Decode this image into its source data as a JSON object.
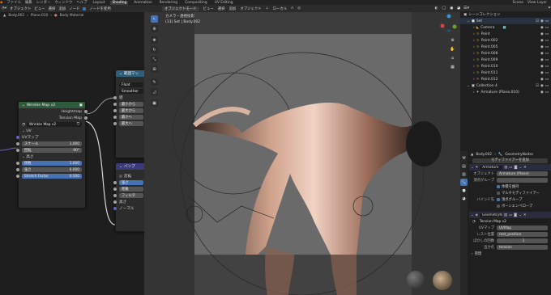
{
  "topbar": {
    "menus": [
      "ファイル",
      "編集",
      "レンダー",
      "ウィンドウ",
      "ヘルプ"
    ],
    "workspaces": [
      "Layout",
      "Shading",
      "Animation",
      "Rendering",
      "Compositing",
      "UV Editing"
    ],
    "active_workspace": "Shading",
    "right_items": [
      "Scene",
      "View Layer"
    ]
  },
  "node_editor": {
    "header": [
      "オブジェクト",
      "ビュー",
      "選択",
      "追加",
      "ノード",
      "ノードを使用"
    ],
    "breadcrumb": [
      "Body.002",
      "Plane.010",
      "Body Material"
    ],
    "wrinkle_node": {
      "title": "Wrinkle Map v2",
      "outputs": [
        "Heightmap",
        "Tension Map"
      ],
      "group_name": "Wrinkle Map v2",
      "section_uv": "UV",
      "uv_map": "UVマップ",
      "scale_label": "スケール",
      "scale_value": "1.000",
      "rotation_label": "回転",
      "rotation_value": "90°",
      "section_height": "高さ",
      "coef_label": "係数",
      "coef_value": "1.000",
      "strength_label": "強さ",
      "strength_value": "6.000",
      "stretch_label": "Stretch Factor",
      "stretch_value": "0.500"
    },
    "map_range_node": {
      "title": "範囲マッ",
      "type_value": "Float",
      "interp_value": "Smoother",
      "sockets": [
        "値",
        "最小から",
        "最大から",
        "最小へ",
        "最大へ"
      ]
    },
    "bump_node": {
      "title": "バンプ",
      "invert": "反転",
      "sockets": [
        "強さ",
        "距離",
        "フィルタ"
      ],
      "bottom": [
        "高さ",
        "ノーマル"
      ]
    }
  },
  "viewport": {
    "header": [
      "オブジェクトモード",
      "ビュー",
      "選択",
      "追加",
      "オブジェクト",
      "ローカル"
    ],
    "camera_title": "カメラ・透視投影",
    "camera_sub": "(13) Set | Body.002"
  },
  "outliner": {
    "title": "シーンコレクション",
    "items": [
      "Set",
      "Camera",
      "Point",
      "Point.002",
      "Point.005",
      "Point.008",
      "Point.009",
      "Point.010",
      "Point.011",
      "Point.012",
      "Collection 4",
      "Armature (Plane.010)"
    ]
  },
  "properties": {
    "breadcrumb": [
      "Body.002",
      "GeometryNodes"
    ],
    "add_modifier": "モディファイアーを追加",
    "armature_name": "Armature",
    "object_label": "オブジェクト",
    "object_value": "Armature (Plane)",
    "vgroup_label": "頂点グループ",
    "preserve_volume": "体積を維持",
    "multi_modifier": "マルチモディファイアー",
    "bind_label": "バインド先",
    "vertex_groups": "頂点グループ",
    "bone_envelopes": "ボーンエンベロープ",
    "gn_name": "GeometryN",
    "tension_map": "Tension Map v2",
    "uv_map_label": "UVマップ",
    "uv_map_value": "UVMap",
    "rest_pos_label": "レスト位置",
    "rest_pos_value": "rest_position",
    "smooth_label": "ぼかしの回数",
    "smooth_value": "1",
    "output_label": "出力名",
    "output_value": "tension",
    "manage": "管理"
  },
  "colors": {
    "group_header": "#2e5b3c",
    "converter_header": "#2d5f7a",
    "vector_header": "#3c3a7a",
    "accent": "#4772b3",
    "modifier_header": "#2b2b40"
  }
}
